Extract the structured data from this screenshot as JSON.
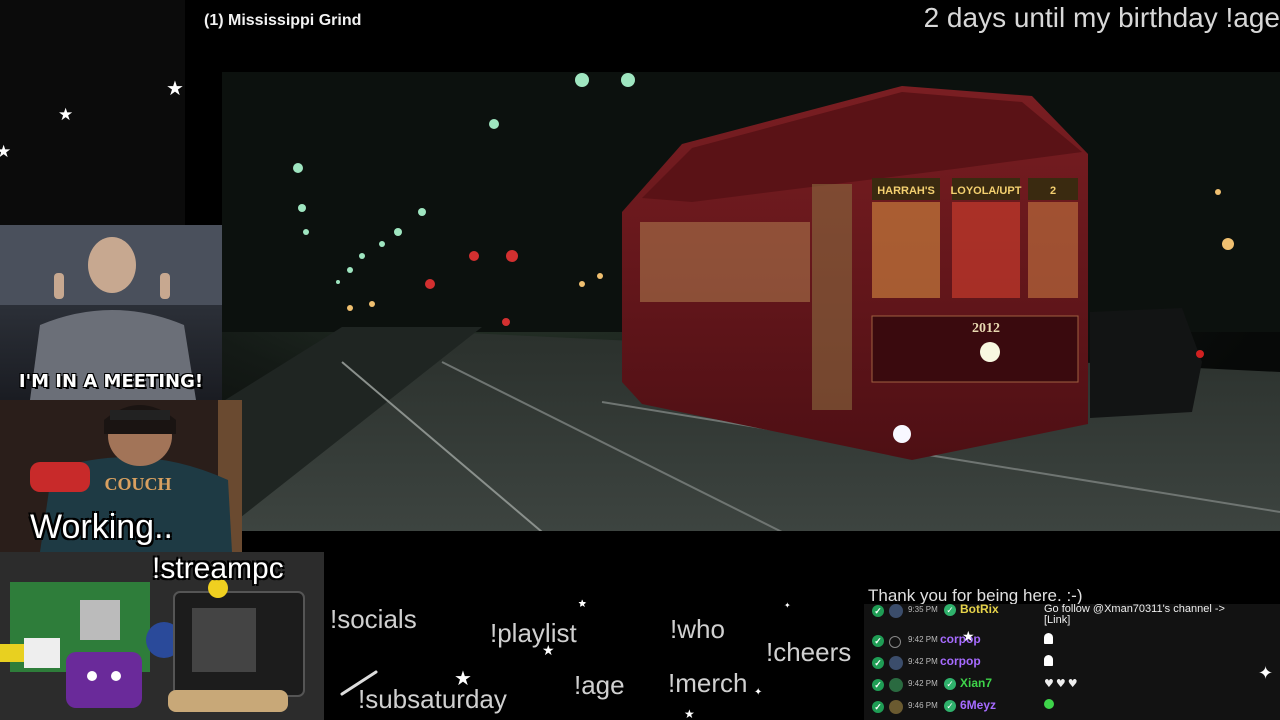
{
  "overlay": {
    "song_title": "(1) Mississippi Grind",
    "birthday_ticker": "2 days until my birthday !age",
    "meeting_caption": "I'M IN A MEETING!",
    "webcam_status": "Working..",
    "pc_label": "!streampc",
    "thanks_message": "Thank you for being here. :-)"
  },
  "commands": [
    "!socials",
    "!playlist",
    "!who",
    "!cheers",
    "!subsaturday",
    "!age",
    "!merch"
  ],
  "video_scene": {
    "streetcar_signs": [
      "HARRAH'S",
      "LOYOLA/UPT",
      "2"
    ],
    "streetcar_number": "2012"
  },
  "chat": {
    "messages": [
      {
        "time": "9:35 PM",
        "user": "BotRix",
        "user_color": "#e6d34a",
        "message": "Go follow @Xman70311's channel ->",
        "message2": "[Link]",
        "icon": ""
      },
      {
        "time": "9:42 PM",
        "user": "corpop",
        "user_color": "#a66bff",
        "message": "",
        "icon": "ghost-icon"
      },
      {
        "time": "9:42 PM",
        "user": "corpop",
        "user_color": "#a66bff",
        "message": "",
        "icon": "ghost-icon"
      },
      {
        "time": "9:42 PM",
        "user": "Xian7",
        "user_color": "#3ed44a",
        "message": "",
        "icon": "green-hearts-icon",
        "hearts": "♥♥♥"
      },
      {
        "time": "9:46 PM",
        "user": "6Meyz",
        "user_color": "#a66bff",
        "message": "",
        "icon": "green-blob-icon"
      }
    ]
  },
  "colors": {
    "background": "#000000",
    "chat_background": "#121212",
    "mod_badge": "#1f9d55"
  }
}
